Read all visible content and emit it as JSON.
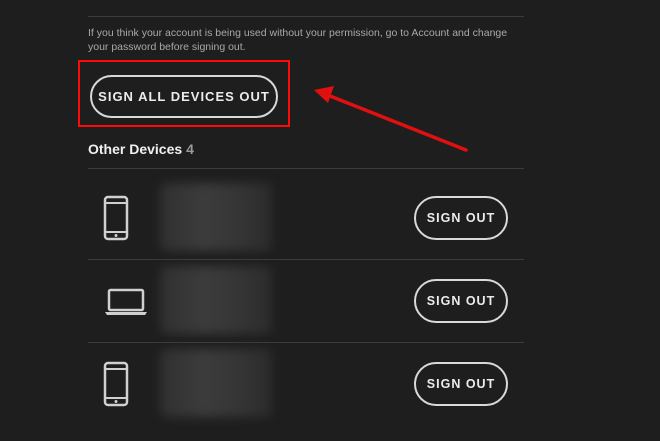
{
  "notice": "If you think your account is being used without your permission, go to Account and change your password before signing out.",
  "sign_all_label": "SIGN ALL DEVICES OUT",
  "other_devices": {
    "title": "Other Devices",
    "count": "4"
  },
  "devices": [
    {
      "icon": "smartphone-icon",
      "sign_out_label": "SIGN OUT"
    },
    {
      "icon": "laptop-icon",
      "sign_out_label": "SIGN OUT"
    },
    {
      "icon": "smartphone-icon",
      "sign_out_label": "SIGN OUT"
    }
  ],
  "colors": {
    "background": "#1e1e1e",
    "highlight": "#ff0a0a",
    "arrow": "#e01010"
  }
}
